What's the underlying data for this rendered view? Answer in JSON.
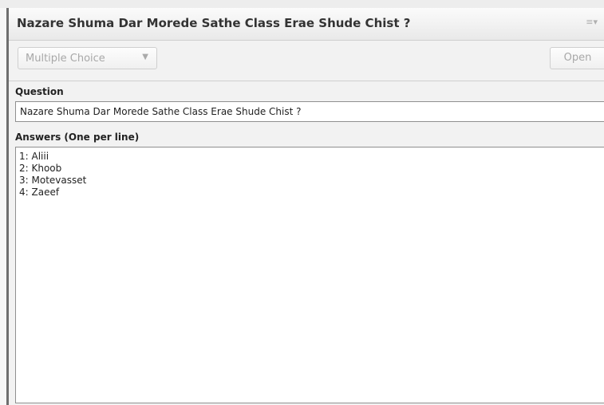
{
  "pod": {
    "title": "Nazare Shuma Dar Morede Sathe Class Erae Shude Chist ?",
    "menu_icon": "≡▾"
  },
  "toolbar": {
    "question_type": "Multiple Choice",
    "dropdown_arrow": "▼",
    "open_label": "Open"
  },
  "question": {
    "label": "Question",
    "value": "Nazare Shuma Dar Morede Sathe Class Erae Shude Chist ?"
  },
  "answers": {
    "label": "Answers (One per line)",
    "lines": [
      "1: Aliii",
      "2: Khoob",
      "3: Motevasset",
      "4: Zaeef"
    ]
  }
}
